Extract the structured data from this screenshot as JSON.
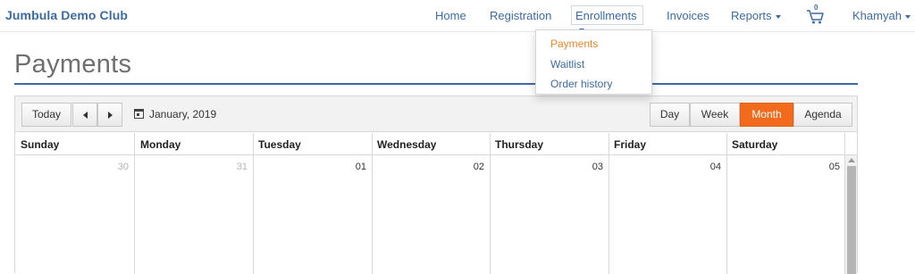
{
  "brand": "Jumbula Demo Club",
  "nav": {
    "home": "Home",
    "registration": "Registration",
    "enrollments": "Enrollments",
    "invoices": "Invoices",
    "reports": "Reports",
    "cart_count": "0",
    "user": "Khamyah"
  },
  "enrollments_menu": {
    "items": [
      "Payments",
      "Waitlist",
      "Order history"
    ],
    "active": "Payments"
  },
  "page": {
    "title": "Payments"
  },
  "calendar": {
    "today_label": "Today",
    "current_period": "January, 2019",
    "views": [
      "Day",
      "Week",
      "Month",
      "Agenda"
    ],
    "active_view": "Month",
    "day_names": [
      "Sunday",
      "Monday",
      "Tuesday",
      "Wednesday",
      "Thursday",
      "Friday",
      "Saturday"
    ],
    "first_week": [
      "30",
      "31",
      "01",
      "02",
      "03",
      "04",
      "05"
    ],
    "other_month_days": [
      "30",
      "31"
    ]
  },
  "colors": {
    "brand_blue": "#3d6aa3",
    "active_orange": "#f26b1d",
    "menu_active": "#e8872b"
  }
}
